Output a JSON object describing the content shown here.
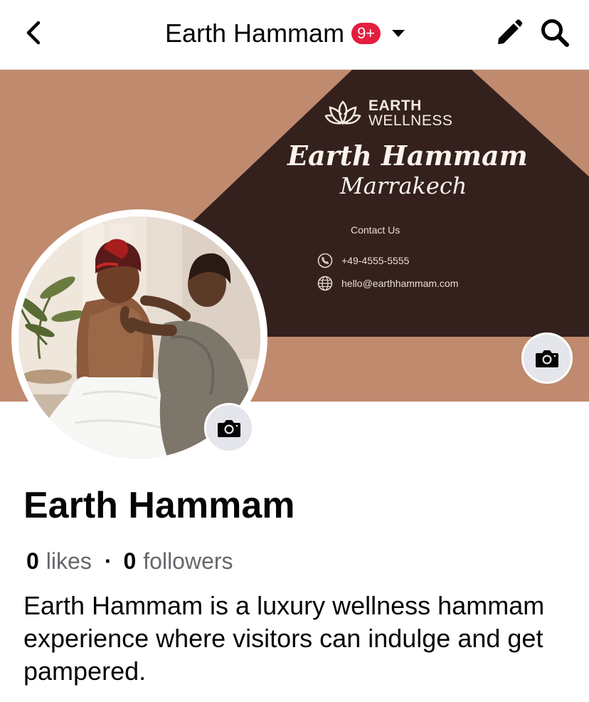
{
  "header": {
    "title": "Earth Hammam",
    "notification_badge": "9+",
    "badge_color": "#e41e3f"
  },
  "cover": {
    "background_color": "#c08a6e",
    "panel_color": "#34211d",
    "brand_top": "EARTH",
    "brand_bottom": "WELLNESS",
    "title": "Earth Hammam",
    "subtitle": "Marrakech",
    "contact_label": "Contact Us",
    "phone": "+49-4555-5555",
    "email": "hello@earthhammam.com"
  },
  "profile": {
    "name": "Earth Hammam",
    "likes_count": "0",
    "likes_label": "likes",
    "followers_count": "0",
    "followers_label": "followers",
    "separator": "·",
    "bio": "Earth Hammam is a luxury wellness hammam experience where visitors can indulge and get pampered."
  },
  "icons": {
    "back": "chevron-left-icon",
    "edit": "pencil-icon",
    "search": "search-icon",
    "camera": "camera-icon",
    "phone": "phone-icon",
    "globe": "globe-icon",
    "brand": "lotus-icon"
  }
}
